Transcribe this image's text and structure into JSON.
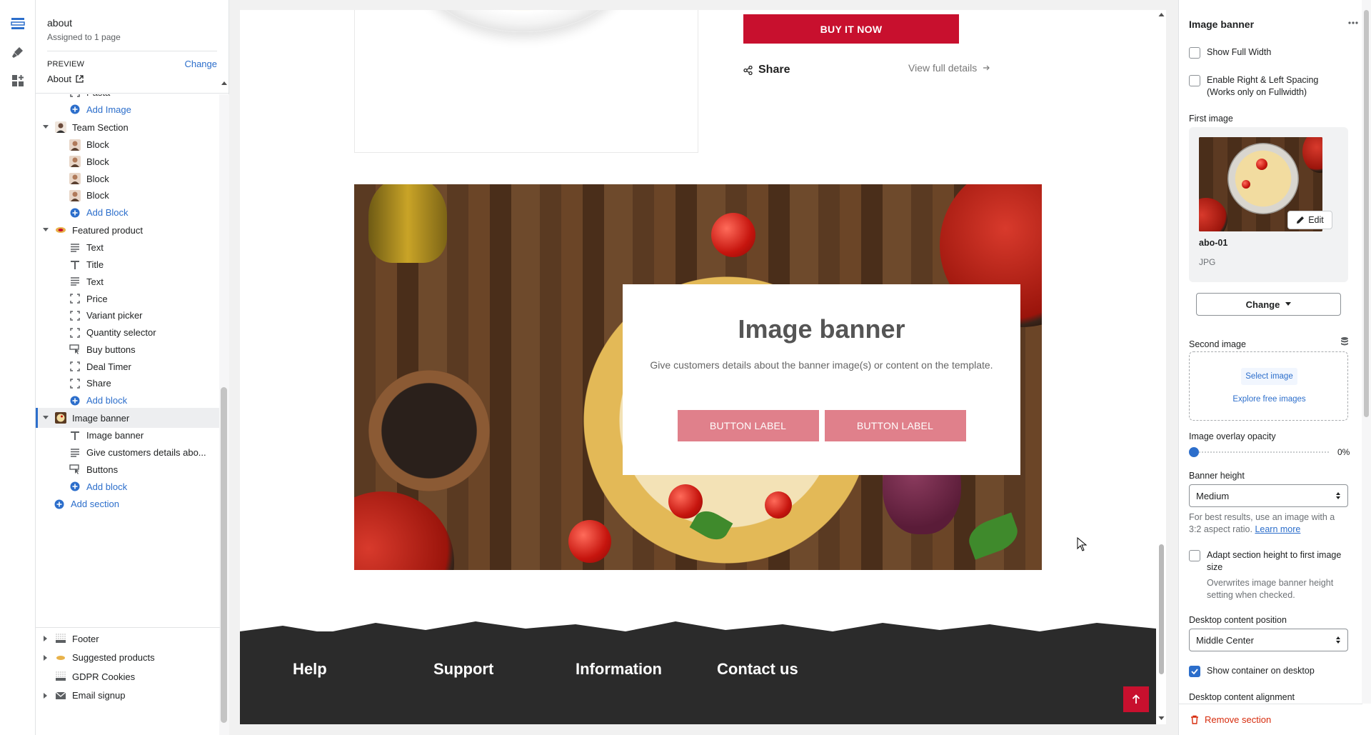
{
  "sidebar": {
    "title": "about",
    "subtitle": "Assigned to 1 page",
    "preview_label": "PREVIEW",
    "change_label": "Change",
    "preview_page": "About",
    "tree": [
      {
        "label": "Pasta",
        "type": "child",
        "icon": "image-block-icon"
      },
      {
        "label": "Add Image",
        "type": "add"
      },
      {
        "label": "Team Section",
        "type": "section",
        "icon": "team-avatar-icon"
      },
      {
        "label": "Block",
        "type": "child",
        "icon": "person-avatar-icon"
      },
      {
        "label": "Block",
        "type": "child",
        "icon": "person-avatar-icon"
      },
      {
        "label": "Block",
        "type": "child",
        "icon": "person-avatar-icon"
      },
      {
        "label": "Block",
        "type": "child",
        "icon": "person-avatar-icon"
      },
      {
        "label": "Add Block",
        "type": "add"
      },
      {
        "label": "Featured product",
        "type": "section",
        "icon": "featured-product-icon"
      },
      {
        "label": "Text",
        "type": "child",
        "icon": "text-lines-icon"
      },
      {
        "label": "Title",
        "type": "child",
        "icon": "title-t-icon"
      },
      {
        "label": "Text",
        "type": "child",
        "icon": "text-lines-icon"
      },
      {
        "label": "Price",
        "type": "child",
        "icon": "frame-block-icon"
      },
      {
        "label": "Variant picker",
        "type": "child",
        "icon": "frame-block-icon"
      },
      {
        "label": "Quantity selector",
        "type": "child",
        "icon": "frame-block-icon"
      },
      {
        "label": "Buy buttons",
        "type": "child",
        "icon": "buttons-icon"
      },
      {
        "label": "Deal Timer",
        "type": "child",
        "icon": "frame-block-icon"
      },
      {
        "label": "Share",
        "type": "child",
        "icon": "frame-block-icon"
      },
      {
        "label": "Add block",
        "type": "add"
      },
      {
        "label": "Image banner",
        "type": "section",
        "icon": "image-banner-thumb-icon",
        "selected": true
      },
      {
        "label": "Image banner",
        "type": "child",
        "icon": "title-t-icon"
      },
      {
        "label": "Give customers details abo...",
        "type": "child",
        "icon": "text-lines-icon"
      },
      {
        "label": "Buttons",
        "type": "child",
        "icon": "buttons-icon"
      },
      {
        "label": "Add block",
        "type": "add"
      },
      {
        "label": "Add section",
        "type": "add-section"
      }
    ],
    "bottom": [
      {
        "label": "Footer",
        "icon": "footer-icon",
        "caret": true
      },
      {
        "label": "Suggested products",
        "icon": "suggested-products-icon",
        "caret": true
      },
      {
        "label": "GDPR Cookies",
        "icon": "cookies-icon",
        "caret": false
      },
      {
        "label": "Email signup",
        "icon": "email-icon",
        "caret": true
      }
    ]
  },
  "canvas": {
    "buy_now": "BUY IT NOW",
    "share": "Share",
    "view_details": "View full details",
    "banner_title": "Image banner",
    "banner_text": "Give customers details about the banner image(s) or content on the template.",
    "button1": "BUTTON LABEL",
    "button2": "BUTTON LABEL",
    "footer_cols": [
      "Help",
      "Support",
      "Information",
      "Contact us"
    ]
  },
  "settings": {
    "title": "Image banner",
    "show_full_width": "Show Full Width",
    "enable_spacing": "Enable Right & Left Spacing (Works only on Fullwidth)",
    "first_image": "First image",
    "edit": "Edit",
    "file_name": "abo-01",
    "file_type": "JPG",
    "change": "Change",
    "second_image": "Second image",
    "select_image": "Select image",
    "explore": "Explore free images",
    "overlay_label": "Image overlay opacity",
    "overlay_value": "0%",
    "overlay_fraction": 0,
    "banner_height_label": "Banner height",
    "banner_height": "Medium",
    "help_text": "For best results, use an image with a 3:2 aspect ratio.",
    "learn_more": "Learn more",
    "adapt_label": "Adapt section height to first image size",
    "adapt_help": "Overwrites image banner height setting when checked.",
    "desktop_pos_label": "Desktop content position",
    "desktop_pos": "Middle Center",
    "show_container": "Show container on desktop",
    "show_container_checked": true,
    "desktop_align_label": "Desktop content alignment",
    "remove": "Remove section"
  },
  "colors": {
    "accent": "#2c6ecb",
    "buy_button": "#c8102e",
    "banner_button": "#e0808b",
    "danger": "#d72c0d"
  }
}
